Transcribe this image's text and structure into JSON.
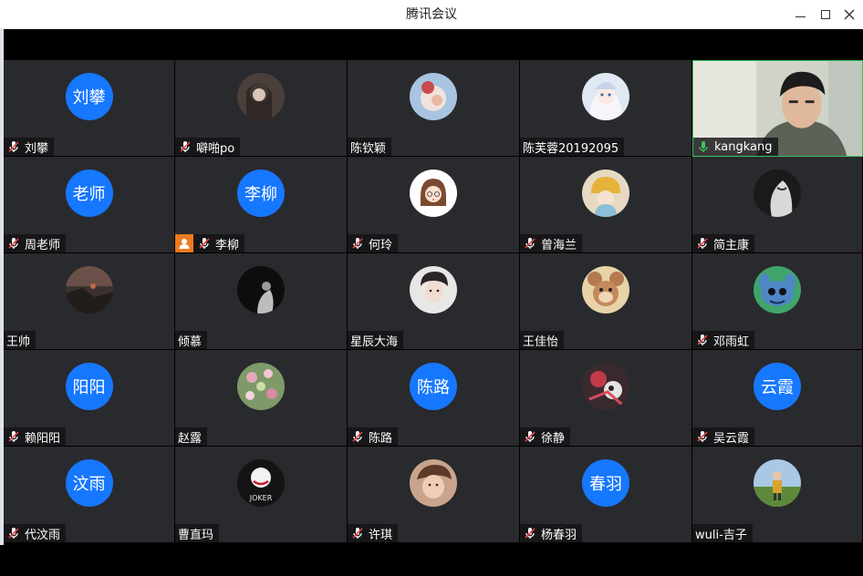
{
  "window": {
    "title": "腾讯会议",
    "controls": {
      "minimize": "minimize-icon",
      "maximize": "maximize-icon",
      "close": "close-icon"
    }
  },
  "colors": {
    "tile_bg": "#292a2e",
    "avatar_blue": "#1677ff",
    "active_border": "#3ec25a",
    "host_badge": "#f07b1e",
    "mic_muted": "#e04343",
    "mic_active": "#3ec25a"
  },
  "participants": [
    {
      "name": "刘攀",
      "avatar_text": "刘攀",
      "mic": "muted"
    },
    {
      "name": "噼啪po",
      "avatar": "photo",
      "mic": "muted"
    },
    {
      "name": "陈钦颖",
      "avatar": "photo",
      "mic": "none"
    },
    {
      "name": "陈芙蓉20192095",
      "avatar": "photo",
      "mic": "none"
    },
    {
      "name": "kangkang",
      "avatar": "video",
      "mic": "active"
    },
    {
      "name": "周老师",
      "avatar_text": "老师",
      "mic": "muted"
    },
    {
      "name": "李柳",
      "avatar_text": "李柳",
      "mic": "muted",
      "host": true
    },
    {
      "name": "何玲",
      "avatar": "photo",
      "mic": "muted"
    },
    {
      "name": "曾海兰",
      "avatar": "photo",
      "mic": "muted"
    },
    {
      "name": "简主康",
      "avatar": "photo",
      "mic": "muted"
    },
    {
      "name": "王帅",
      "avatar": "photo",
      "mic": "none"
    },
    {
      "name": "倾慕",
      "avatar": "photo",
      "mic": "none"
    },
    {
      "name": "星辰大海",
      "avatar": "photo",
      "mic": "none"
    },
    {
      "name": "王佳怡",
      "avatar": "photo",
      "mic": "none"
    },
    {
      "name": "邓雨虹",
      "avatar": "photo",
      "mic": "muted"
    },
    {
      "name": "赖阳阳",
      "avatar_text": "阳阳",
      "mic": "muted"
    },
    {
      "name": "赵露",
      "avatar": "photo",
      "mic": "none"
    },
    {
      "name": "陈路",
      "avatar_text": "陈路",
      "mic": "muted"
    },
    {
      "name": "徐静",
      "avatar": "photo",
      "mic": "muted"
    },
    {
      "name": "吴云霞",
      "avatar_text": "云霞",
      "mic": "muted"
    },
    {
      "name": "代汶雨",
      "avatar_text": "汶雨",
      "mic": "muted"
    },
    {
      "name": "曹直玛",
      "avatar": "photo",
      "mic": "none"
    },
    {
      "name": "许琪",
      "avatar": "photo",
      "mic": "muted"
    },
    {
      "name": "杨春羽",
      "avatar_text": "春羽",
      "mic": "muted"
    },
    {
      "name": "wuli-吉子",
      "avatar": "photo",
      "mic": "none"
    }
  ],
  "photo_text": {
    "joker": "JOKER"
  }
}
